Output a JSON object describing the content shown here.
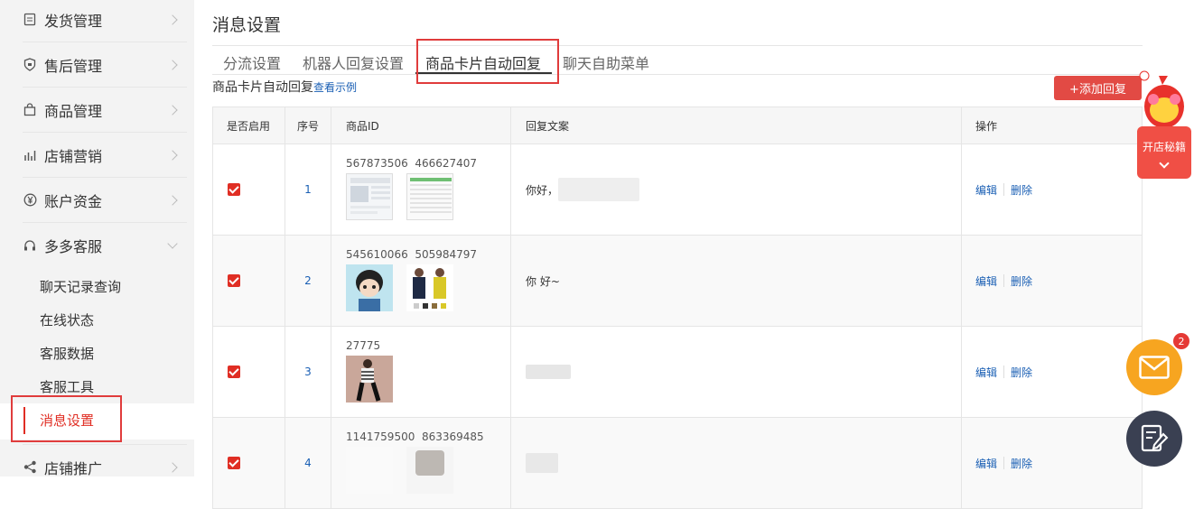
{
  "sidebar": {
    "menu": [
      {
        "label": "发货管理",
        "icon": "clipboard-icon"
      },
      {
        "label": "售后管理",
        "icon": "shield-icon"
      },
      {
        "label": "商品管理",
        "icon": "bag-icon"
      },
      {
        "label": "店铺营销",
        "icon": "chart-icon"
      },
      {
        "label": "账户资金",
        "icon": "yen-icon"
      },
      {
        "label": "多多客服",
        "icon": "headset-icon"
      }
    ],
    "sub_items": [
      "聊天记录查询",
      "在线状态",
      "客服数据",
      "客服工具",
      "消息设置"
    ],
    "bottom_item": {
      "label": "店铺推广",
      "icon": "share-icon"
    }
  },
  "header": {
    "title": "消息设置"
  },
  "tabs": [
    "分流设置",
    "机器人回复设置",
    "商品卡片自动回复",
    "聊天自助菜单"
  ],
  "section": {
    "desc": "商品卡片自动回复",
    "example_link": "查看示例",
    "add_button": "+添加回复"
  },
  "table": {
    "columns": [
      "是否启用",
      "序号",
      "商品ID",
      "回复文案",
      "操作"
    ],
    "rows": [
      {
        "index": "1",
        "ids": "567873506  466627407",
        "reply": "你好，",
        "enabled": true
      },
      {
        "index": "2",
        "ids": "545610066  505984797",
        "reply": "你 好~",
        "enabled": true
      },
      {
        "index": "3",
        "ids": "27775",
        "reply": "",
        "enabled": true
      },
      {
        "index": "4",
        "ids": "1141759500  863369485",
        "reply": "",
        "enabled": true
      }
    ],
    "ops": {
      "edit": "编辑",
      "delete": "删除"
    }
  },
  "widgets": {
    "mascot_label": "开店秘籍",
    "mail_badge": "2"
  },
  "colors": {
    "accent": "#e02e24",
    "link": "#1a5fb4",
    "mail": "#f7a520",
    "edit": "#3a4052"
  }
}
